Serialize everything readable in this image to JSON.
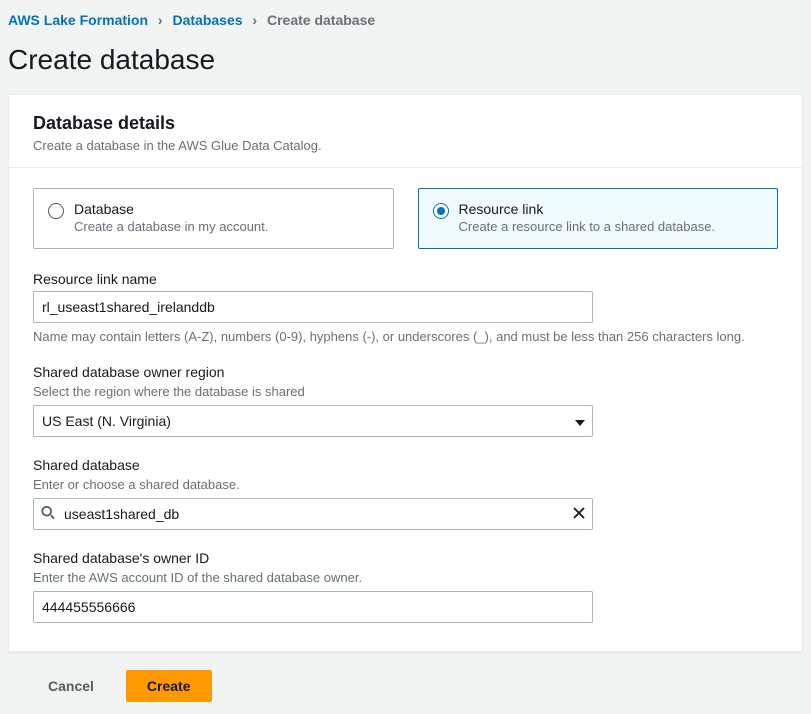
{
  "breadcrumb": {
    "root": "AWS Lake Formation",
    "level1": "Databases",
    "current": "Create database"
  },
  "page": {
    "title": "Create database"
  },
  "panel": {
    "title": "Database details",
    "desc": "Create a database in the AWS Glue Data Catalog."
  },
  "tiles": {
    "database": {
      "title": "Database",
      "sub": "Create a database in my account."
    },
    "resource_link": {
      "title": "Resource link",
      "sub": "Create a resource link to a shared database."
    }
  },
  "fields": {
    "rl_name": {
      "label": "Resource link name",
      "value": "rl_useast1shared_irelanddb",
      "help": "Name may contain letters (A-Z), numbers (0-9), hyphens (-), or underscores (_), and must be less than 256 characters long."
    },
    "owner_region": {
      "label": "Shared database owner region",
      "hint": "Select the region where the database is shared",
      "value": "US East (N. Virginia)"
    },
    "shared_db": {
      "label": "Shared database",
      "hint": "Enter or choose a shared database.",
      "value": "useast1shared_db"
    },
    "owner_id": {
      "label": "Shared database's owner ID",
      "hint": "Enter the AWS account ID of the shared database owner.",
      "value": "444455556666"
    }
  },
  "footer": {
    "cancel": "Cancel",
    "create": "Create"
  }
}
